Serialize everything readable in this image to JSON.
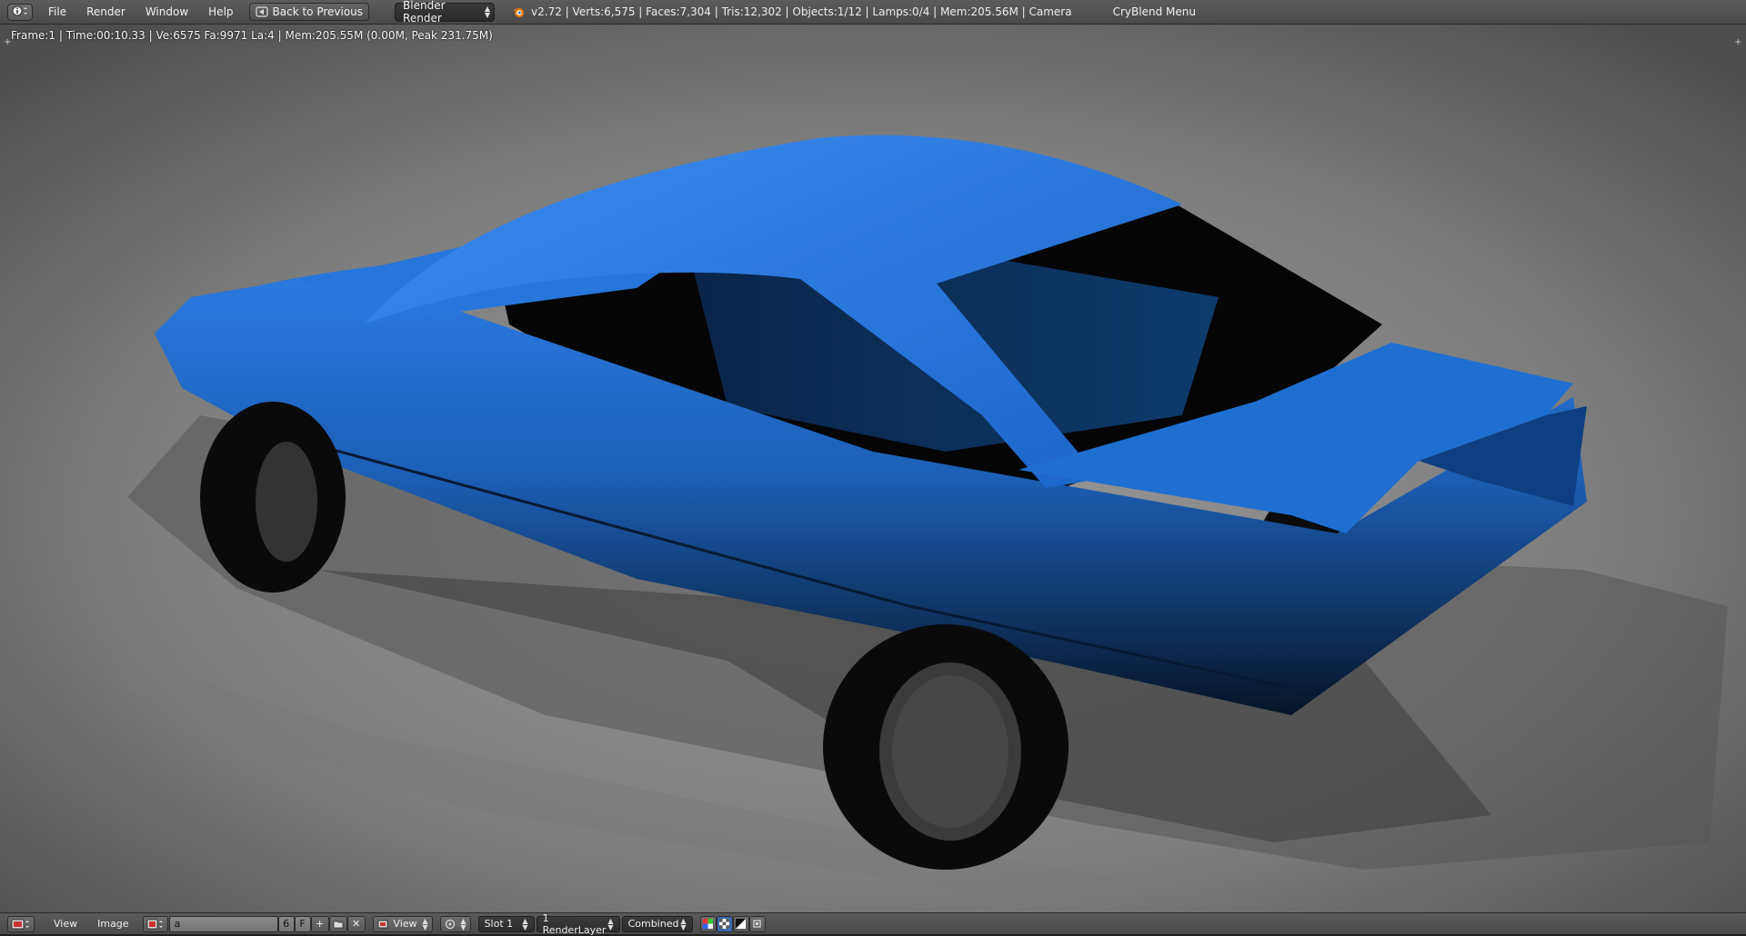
{
  "topbar": {
    "menu": [
      "File",
      "Render",
      "Window",
      "Help"
    ],
    "back_label": "Back to Previous",
    "engine": "Blender Render",
    "stats": "v2.72 | Verts:6,575 | Faces:7,304 | Tris:12,302 | Objects:1/12 | Lamps:0/4 | Mem:205.56M | Camera",
    "addon_menu": "CryBlend Menu"
  },
  "render": {
    "info": "Frame:1 | Time:00:10.33 | Ve:6575 Fa:9971 La:4 | Mem:205.55M (0.00M, Peak 231.75M)",
    "car_color": "#1f6fd1",
    "background_color": "#6b6b6b"
  },
  "bottombar": {
    "menu": [
      "View",
      "Image"
    ],
    "image_name": "a",
    "users": "6",
    "fake_user": "F",
    "view_select": "View",
    "slot_select": "Slot 1",
    "layer_select": "1 RenderLayer",
    "pass_select": "Combined"
  },
  "icons": {
    "editor_type": "info-icon",
    "engine_logo": "blender-logo-icon",
    "image_editor": "image-editor-icon",
    "back": "back-icon"
  }
}
